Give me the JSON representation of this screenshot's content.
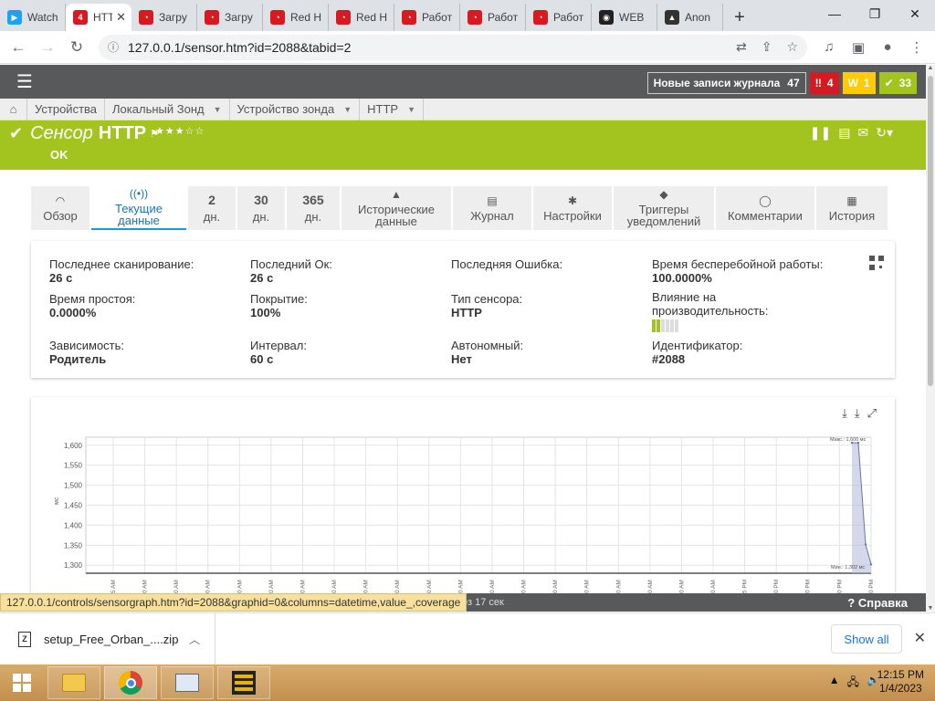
{
  "browser": {
    "tabs": [
      {
        "title": "Watch",
        "color": "#1da1f2",
        "glyph": "▶"
      },
      {
        "title": "HTTP",
        "color": "#d71920",
        "glyph": "4",
        "active": true
      },
      {
        "title": "Загру",
        "color": "#d71920",
        "glyph": "◔"
      },
      {
        "title": "Загру",
        "color": "#d71920",
        "glyph": "◔"
      },
      {
        "title": "Red H",
        "color": "#d71920",
        "glyph": "◔"
      },
      {
        "title": "Red H",
        "color": "#d71920",
        "glyph": "◔"
      },
      {
        "title": "Работ",
        "color": "#d71920",
        "glyph": "◔"
      },
      {
        "title": "Работ",
        "color": "#d71920",
        "glyph": "◔"
      },
      {
        "title": "Работ",
        "color": "#d71920",
        "glyph": "◔"
      },
      {
        "title": "WEB",
        "color": "#222222",
        "glyph": "◉"
      },
      {
        "title": "Anon",
        "color": "#333333",
        "glyph": "▲"
      }
    ],
    "url": "127.0.0.1/sensor.htm?id=2088&tabid=2"
  },
  "header": {
    "log_label": "Новые записи журнала",
    "log_count": "47",
    "alarm_count": "4",
    "warning_count": "1",
    "ok_count": "33",
    "colors": {
      "bar": "#58595b",
      "red": "#d71920",
      "yellow": "#ffcb05",
      "green": "#a3c31f"
    }
  },
  "breadcrumb": [
    {
      "label": "Устройства",
      "dropdown": false
    },
    {
      "label": "Локальный Зонд",
      "dropdown": true
    },
    {
      "label": "Устройство зонда",
      "dropdown": true
    },
    {
      "label": "HTTP",
      "dropdown": true
    }
  ],
  "sensor": {
    "title_prefix": "Сенсор",
    "name": "HTTP",
    "status": "OK",
    "rating_stars": 3,
    "rating_max": 5,
    "stars_text": "★★★☆☆"
  },
  "tabs": [
    {
      "icon": "gauge-icon",
      "glyph": "◠",
      "label1": "Обзор",
      "label2": ""
    },
    {
      "icon": "live-data-icon",
      "glyph": "((•))",
      "label1": "Текущие",
      "label2": "данные",
      "active": true
    },
    {
      "num": "2",
      "label1": "дн."
    },
    {
      "num": "30",
      "label1": "дн."
    },
    {
      "num": "365",
      "label1": "дн."
    },
    {
      "icon": "area-chart-icon",
      "glyph": "▲",
      "label1": "Исторические",
      "label2": "данные"
    },
    {
      "icon": "log-icon",
      "glyph": "▤",
      "label1": "Журнал",
      "label2": ""
    },
    {
      "icon": "gear-icon",
      "glyph": "✱",
      "label1": "Настройки",
      "label2": ""
    },
    {
      "icon": "bell-icon",
      "glyph": "◆",
      "label1": "Триггеры",
      "label2": "уведомлений"
    },
    {
      "icon": "comment-icon",
      "glyph": "◯",
      "label1": "Комментарии",
      "label2": ""
    },
    {
      "icon": "history-icon",
      "glyph": "▦",
      "label1": "История",
      "label2": ""
    }
  ],
  "info": {
    "last_scan_label": "Последнее сканирование:",
    "last_scan": "26 с",
    "last_ok_label": "Последний Ок:",
    "last_ok": "26 с",
    "last_error_label": "Последняя Ошибка:",
    "uptime_label": "Время бесперебойной работы:",
    "uptime": "100.0000%",
    "downtime_label": "Время простоя:",
    "downtime": "0.0000%",
    "coverage_label": "Покрытие:",
    "coverage": "100%",
    "type_label": "Тип сенсора:",
    "type": "HTTP",
    "impact_label1": "Влияние на",
    "impact_label2": "производительность:",
    "impact_level": 2,
    "impact_max": 6,
    "dependency_label": "Зависимость:",
    "dependency": "Родитель",
    "interval_label": "Интервал:",
    "interval": "60 с",
    "standalone_label": "Автономный:",
    "standalone": "Нет",
    "id_label": "Идентификатор:",
    "id": "#2088"
  },
  "chart_data": {
    "type": "area",
    "ylabel": "мс",
    "ylim": [
      1280,
      1620
    ],
    "yticks": [
      "1,600",
      "1,550",
      "1,500",
      "1,450",
      "1,400",
      "1,350",
      "1,300"
    ],
    "ytick_values": [
      1600,
      1550,
      1500,
      1450,
      1400,
      1350,
      1300
    ],
    "xtick_labels": [
      "5 AM",
      "0 AM",
      "0 AM",
      "0 AM",
      "0 AM",
      "0 AM",
      "0 AM",
      "0 AM",
      "0 AM",
      "0 AM",
      "0 AM",
      "0 AM",
      "0 AM",
      "0 AM",
      "0 AM",
      "0 AM",
      "0 AM",
      "0 AM",
      "0 AM",
      "0 AM",
      "5 PM",
      "0 PM",
      "0 PM",
      "0 PM",
      "0 PM"
    ],
    "series": [
      {
        "values": [
          1606,
          1606,
          1352,
          1302
        ]
      }
    ],
    "annotations": {
      "max": "Макс.: 1,606 мс",
      "min": "Мин.: 1,302 мс"
    },
    "grid": true,
    "color": "#b0b8d8"
  },
  "footer": {
    "refresh_text": "рез 17 сек",
    "help": "Справка",
    "status_url": "127.0.0.1/controls/sensorgraph.htm?id=2088&graphid=0&columns=datetime,value_,coverage"
  },
  "download": {
    "filename": "setup_Free_Orban_....zip",
    "show_all": "Show all"
  },
  "taskbar": {
    "time": "12:15 PM",
    "date": "1/4/2023"
  }
}
